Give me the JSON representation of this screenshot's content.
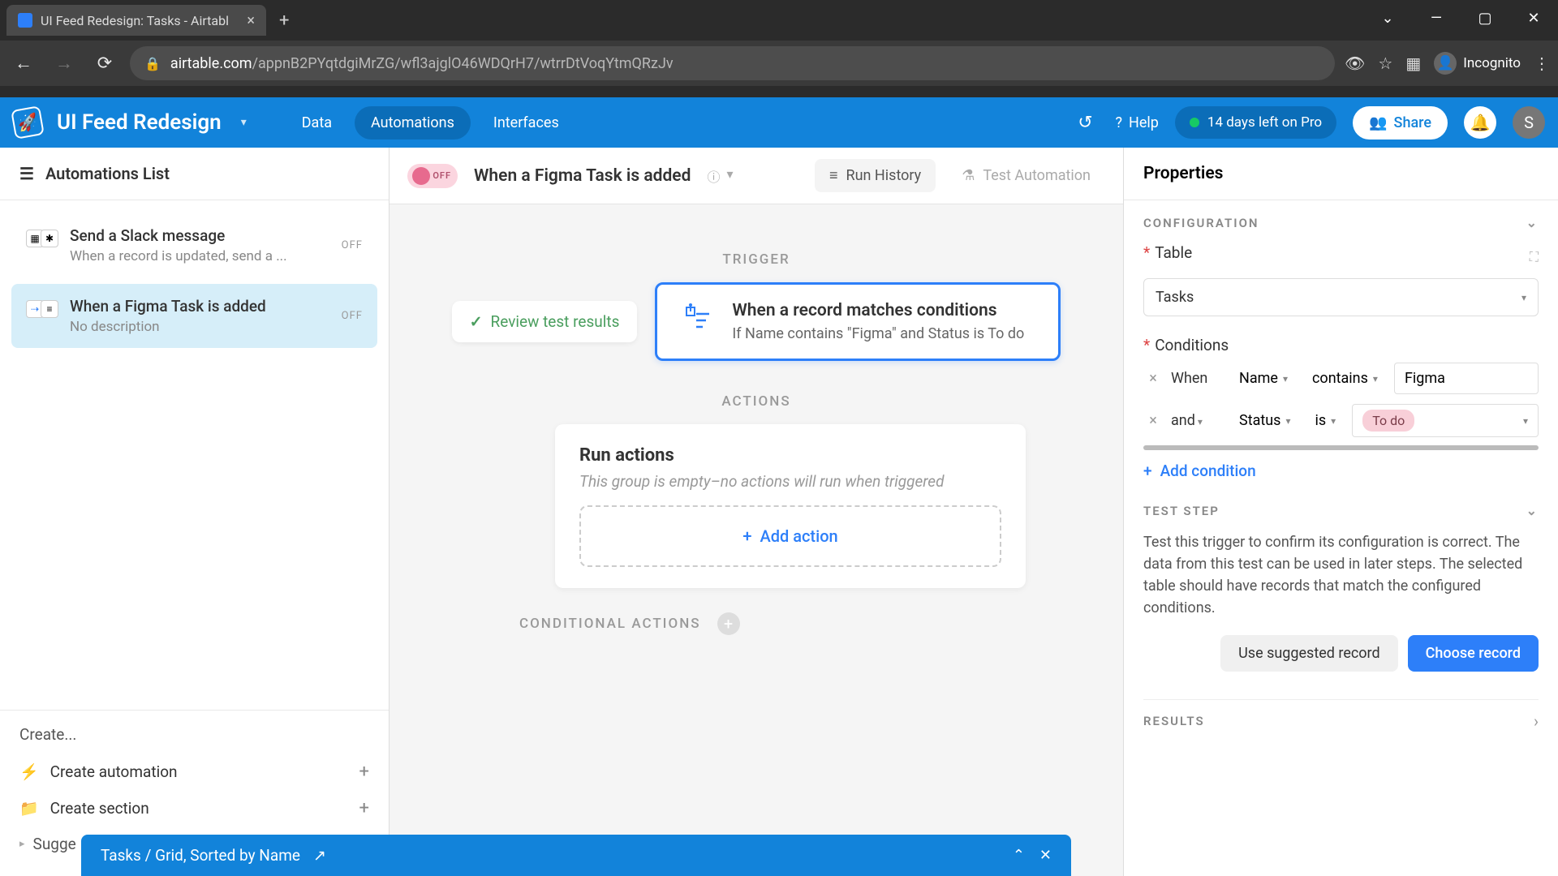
{
  "browser": {
    "tab_title": "UI Feed Redesign: Tasks - Airtabl",
    "url_domain": "airtable.com",
    "url_path": "/appnB2PYqtdgiMrZG/wfl3ajglO46WDQrH7/wtrrDtVoqYtmQRzJv",
    "incognito": "Incognito"
  },
  "header": {
    "app_title": "UI Feed Redesign",
    "tabs": {
      "data": "Data",
      "automations": "Automations",
      "interfaces": "Interfaces"
    },
    "help": "Help",
    "trial": "14 days left on Pro",
    "share": "Share",
    "avatar_initial": "S"
  },
  "sidebar": {
    "title": "Automations List",
    "items": [
      {
        "title": "Send a Slack message",
        "desc": "When a record is updated, send a ...",
        "status": "OFF"
      },
      {
        "title": "When a Figma Task is added",
        "desc": "No description",
        "status": "OFF"
      }
    ],
    "create_label": "Create...",
    "create_automation": "Create automation",
    "create_section": "Create section",
    "suggest": "Sugge"
  },
  "canvas": {
    "toggle_label": "OFF",
    "title": "When a Figma Task is added",
    "run_history": "Run History",
    "test_automation": "Test Automation",
    "trigger_section": "TRIGGER",
    "review_results": "Review test results",
    "trigger_title": "When a record matches conditions",
    "trigger_sub": "If Name contains \"Figma\" and Status is To do",
    "actions_section": "ACTIONS",
    "run_actions_title": "Run actions",
    "run_actions_sub": "This group is empty–no actions will run when triggered",
    "add_action": "Add action",
    "cond_actions": "CONDITIONAL ACTIONS"
  },
  "properties": {
    "title": "Properties",
    "configuration": "CONFIGURATION",
    "table_label": "Table",
    "table_value": "Tasks",
    "conditions_label": "Conditions",
    "conditions": [
      {
        "conj": "When",
        "conj_dd": false,
        "field": "Name",
        "op": "contains",
        "value": "Figma",
        "value_type": "text"
      },
      {
        "conj": "and",
        "conj_dd": true,
        "field": "Status",
        "op": "is",
        "value": "To do",
        "value_type": "select"
      }
    ],
    "add_condition": "Add condition",
    "test_step": "TEST STEP",
    "test_desc": "Test this trigger to confirm its configuration is correct. The data from this test can be used in later steps. The selected table should have records that match the configured conditions.",
    "use_suggested": "Use suggested record",
    "choose_record": "Choose record",
    "results": "RESULTS"
  },
  "toast": {
    "text": "Tasks / Grid, Sorted by Name"
  }
}
